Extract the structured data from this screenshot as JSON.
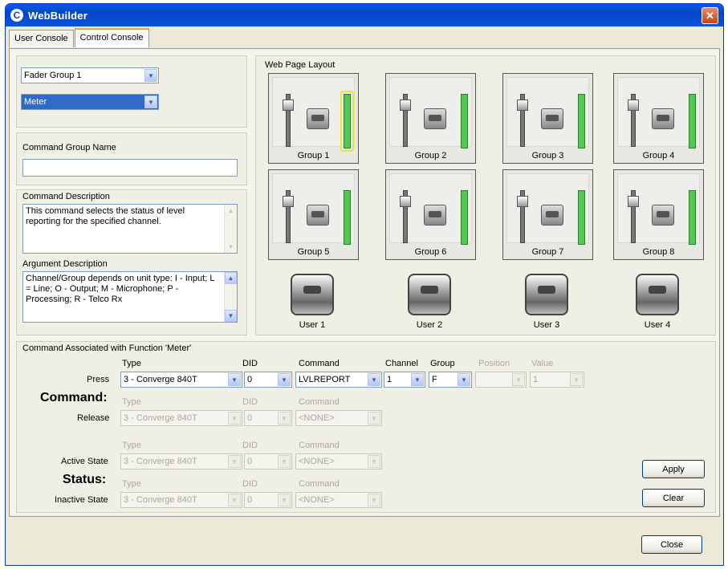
{
  "window": {
    "title": "WebBuilder",
    "close_glyph": "✕",
    "app_icon": "C"
  },
  "tabs": [
    "User Console",
    "Control Console"
  ],
  "left": {
    "fader_group_select": "Fader Group 1",
    "function_select": "Meter",
    "command_group_name_label": "Command Group Name",
    "command_group_name_value": "",
    "command_description_label": "Command Description",
    "command_description_text": "This command selects the status of level reporting for the specified channel.",
    "argument_description_label": "Argument Description",
    "argument_description_text": "Channel/Group depends on unit type: I - Input; L = Line; O - Output; M - Microphone; P - Processing; R - Telco Rx"
  },
  "layout": {
    "label": "Web Page Layout",
    "groups": [
      "Group 1",
      "Group 2",
      "Group 3",
      "Group 4",
      "Group 5",
      "Group 6",
      "Group 7",
      "Group 8"
    ],
    "users": [
      "User 1",
      "User 2",
      "User 3",
      "User 4"
    ]
  },
  "commands": {
    "section_label": "Command Associated with Function 'Meter'",
    "command_heading": "Command:",
    "status_heading": "Status:",
    "col_type": "Type",
    "col_did": "DID",
    "col_command": "Command",
    "col_channel": "Channel",
    "col_group": "Group",
    "col_position": "Position",
    "col_value": "Value",
    "press_label": "Press",
    "release_label": "Release",
    "active_label": "Active State",
    "inactive_label": "Inactive State",
    "press": {
      "type": "3 - Converge 840T",
      "did": "0",
      "command": "LVLREPORT",
      "channel": "1",
      "group": "F",
      "position": "",
      "value": "1"
    },
    "release": {
      "type": "3 - Converge 840T",
      "did": "0",
      "command": "<NONE>"
    },
    "active": {
      "type": "3 - Converge 840T",
      "did": "0",
      "command": "<NONE>"
    },
    "inactive": {
      "type": "3 - Converge 840T",
      "did": "0",
      "command": "<NONE>"
    }
  },
  "buttons": {
    "apply": "Apply",
    "clear": "Clear",
    "close": "Close"
  },
  "icons": {
    "dropdown": "▼",
    "scroll_up": "▲",
    "scroll_down": "▼"
  }
}
